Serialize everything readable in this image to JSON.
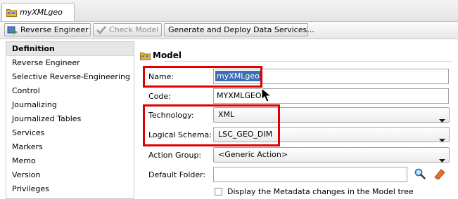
{
  "editor": {
    "tab_title": "myXMLgeo",
    "tab_icon": "model-folder-icon"
  },
  "toolbar": {
    "reverse_engineer": "Reverse Engineer",
    "check_model": "Check Model",
    "generate_deploy": "Generate and Deploy Data Services..."
  },
  "nav": {
    "items": [
      {
        "label": "Definition",
        "selected": true
      },
      {
        "label": "Reverse Engineer"
      },
      {
        "label": "Selective Reverse-Engineering"
      },
      {
        "label": "Control"
      },
      {
        "label": "Journalizing"
      },
      {
        "label": "Journalized Tables"
      },
      {
        "label": "Services"
      },
      {
        "label": "Markers"
      },
      {
        "label": "Memo"
      },
      {
        "label": "Version"
      },
      {
        "label": "Privileges"
      }
    ]
  },
  "form": {
    "section_title": "Model",
    "name_label": "Name:",
    "name_value": "myXMLgeo",
    "code_label": "Code:",
    "code_value": "MYXMLGEO",
    "technology_label": "Technology:",
    "technology_value": "XML",
    "logical_schema_label": "Logical Schema:",
    "logical_schema_value": "LSC_GEO_DIM",
    "action_group_label": "Action Group:",
    "action_group_value": "<Generic Action>",
    "default_folder_label": "Default Folder:",
    "default_folder_value": "",
    "display_metadata_label": "Display the Metadata changes in the Model tree",
    "display_metadata_checked": false
  },
  "colors": {
    "highlight_box": "#e00000",
    "selection": "#3b6eb4"
  }
}
